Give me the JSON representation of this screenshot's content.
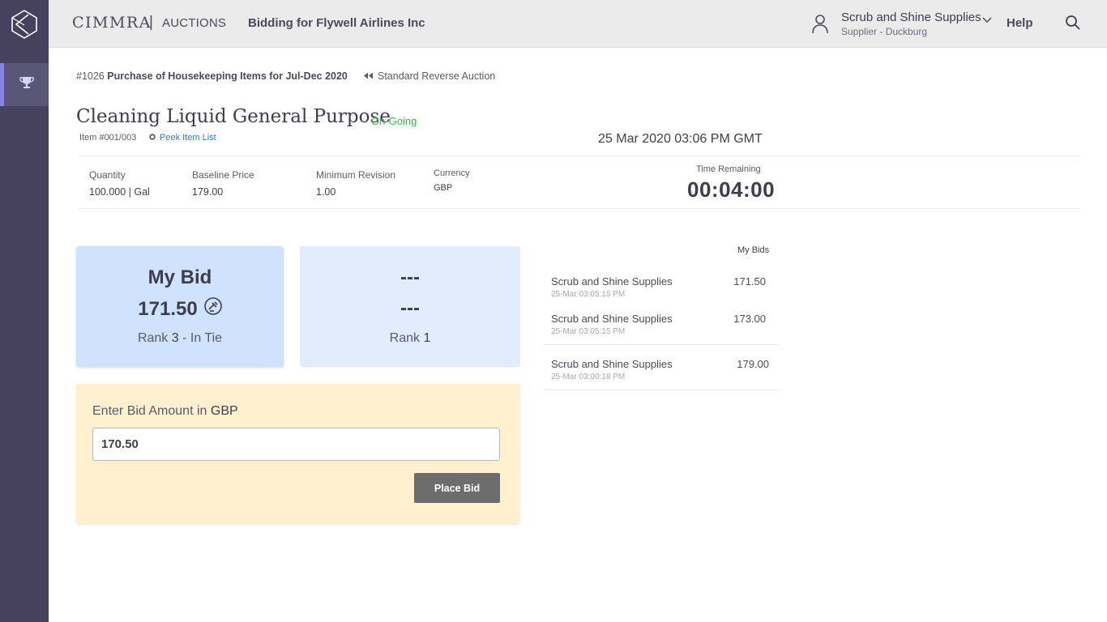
{
  "header": {
    "brand": "CIMMRA",
    "brand_separator": "|",
    "module": "AUCTIONS",
    "context": "Bidding for Flywell Airlines Inc",
    "user_name": "Scrub and Shine Supplies",
    "user_role": "Supplier - Duckburg",
    "help": "Help",
    "icons": [
      "cimmra-logo-icon",
      "trophy-icon",
      "user-icon",
      "chevron-down-icon",
      "search-icon"
    ]
  },
  "auction": {
    "number": "#1026",
    "name": "Purchase of Housekeeping Items for Jul-Dec 2020",
    "type": "Standard Reverse Auction"
  },
  "item": {
    "title": "Cleaning Liquid General Purpose",
    "status": "On-Going",
    "number": "Item #001/003",
    "peek_link": "Peek Item List",
    "datetime": "25 Mar 2020 03:06 PM GMT"
  },
  "meta": {
    "quantity_label": "Quantity",
    "quantity_value": "100.000 | Gal",
    "baseline_label": "Baseline Price",
    "baseline_value": "179.00",
    "min_revision_label": "Minimum Revision",
    "min_revision_value": "1.00",
    "currency_label": "Currency",
    "currency_value": "GBP",
    "time_label": "Time Remaining",
    "time_value": "00:04:00"
  },
  "my_bid_card": {
    "title": "My Bid",
    "amount": "171.50",
    "rank_prefix": "Rank",
    "rank": "3",
    "rank_suffix": "- In Tie"
  },
  "top_card": {
    "line1": "---",
    "line2": "---",
    "rank_prefix": "Rank",
    "rank": "1"
  },
  "bid_form": {
    "label": "Enter Bid Amount in",
    "currency": "GBP",
    "value": "170.50",
    "button": "Place Bid"
  },
  "my_bids": {
    "title": "My Bids",
    "items": [
      {
        "supplier": "Scrub and Shine Supplies",
        "time": "25-Mar 03:05:15 PM",
        "amount": "171.50"
      },
      {
        "supplier": "Scrub and Shine Supplies",
        "time": "25-Mar 03:05:15 PM",
        "amount": "173.00"
      },
      {
        "supplier": "Scrub and Shine Supplies",
        "time": "25-Mar 03:00:18 PM",
        "amount": "179.00"
      }
    ]
  },
  "colors": {
    "rail": "#46425e",
    "accent": "#8b84e6",
    "status_green": "#3db84a",
    "link_blue": "#2a7fd4",
    "my_bid_card": "#cfe3ff",
    "top_card": "#e1edfc",
    "bid_panel": "#fff0cf",
    "button": "#6d6d6d"
  }
}
